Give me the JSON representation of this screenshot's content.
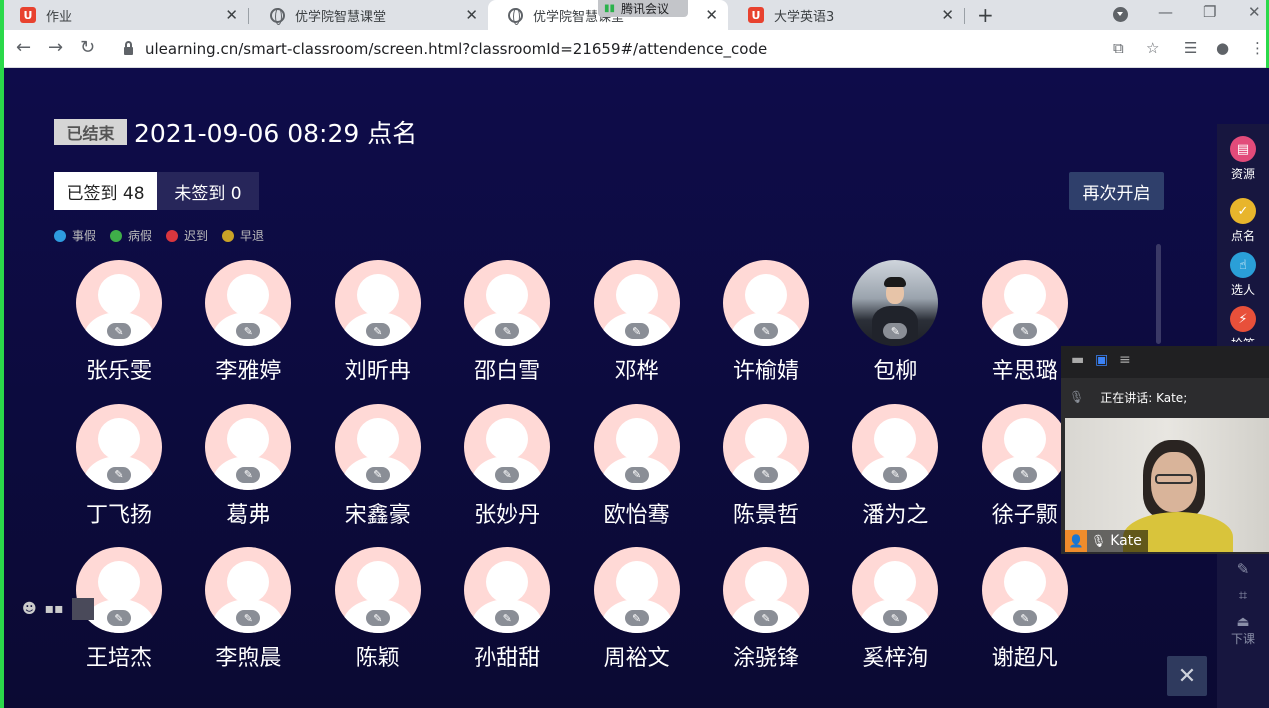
{
  "browser": {
    "tabs": [
      {
        "title": "作业",
        "icon": "ulearning-icon"
      },
      {
        "title": "优学院智慧课堂",
        "icon": "globe-icon"
      },
      {
        "title": "优学院智慧课堂",
        "icon": "globe-icon"
      },
      {
        "title": "大学英语3",
        "icon": "ulearning-icon"
      }
    ],
    "meeting_badge": "腾讯会议",
    "url": "ulearning.cn/smart-classroom/screen.html?classroomId=21659#/attendence_code"
  },
  "attendance": {
    "status_tag": "已结束",
    "title": "2021-09-06 08:29 点名",
    "signed_tab": "已签到 48",
    "unsigned_tab": "未签到 0",
    "reopen_label": "再次开启",
    "legend": [
      {
        "label": "事假",
        "color": "#2e9bdf"
      },
      {
        "label": "病假",
        "color": "#3fae49"
      },
      {
        "label": "迟到",
        "color": "#d9363e"
      },
      {
        "label": "早退",
        "color": "#c9a227"
      }
    ],
    "students": [
      "张乐雯",
      "李雅婷",
      "刘昕冉",
      "邵白雪",
      "邓桦",
      "许榆婧",
      "包柳",
      "辛思璐",
      "丁飞扬",
      "葛弗",
      "宋鑫豪",
      "张妙丹",
      "欧怡骞",
      "陈景哲",
      "潘为之",
      "徐子颢",
      "王培杰",
      "李煦晨",
      "陈颖",
      "孙甜甜",
      "周裕文",
      "涂骁锋",
      "奚梓洵",
      "谢超凡"
    ]
  },
  "sidebar": {
    "items": [
      {
        "label": "资源",
        "color": "#e24b7a"
      },
      {
        "label": "点名",
        "color": "#e8b52c"
      },
      {
        "label": "选人",
        "color": "#2a9fd8"
      },
      {
        "label": "抢答",
        "color": "#e8503a"
      }
    ],
    "bottom_label": "下课"
  },
  "meeting": {
    "speaking": "正在讲话: Kate;",
    "participant": "Kate"
  }
}
